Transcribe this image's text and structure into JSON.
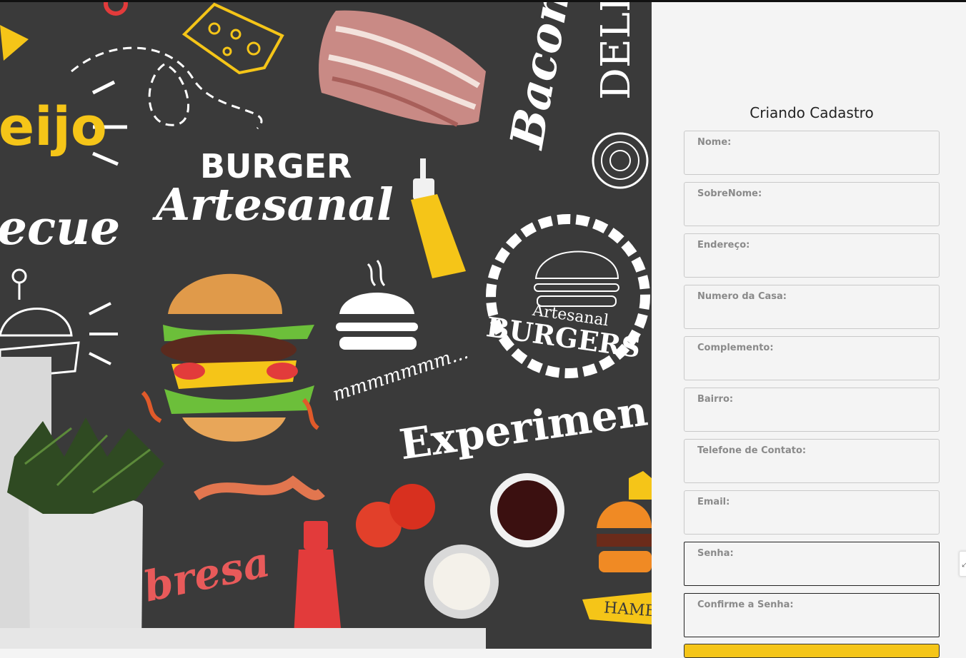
{
  "hero": {
    "texts": {
      "queijo": "eijo",
      "barbecue": "ecue",
      "burger_title": "BURGER",
      "artesanal": "Artesanal",
      "bacon": "Bacon",
      "delicious": "DELIC",
      "badge_artesanal": "Artesanal",
      "badge_burgers": "BURGERS",
      "mmm": "mmmmmmm...",
      "experimente": "Experimen",
      "calabresa": "bresa",
      "hamburger": "HAMB"
    },
    "colors": {
      "board": "#3a3a3a",
      "yellow": "#f5c518",
      "red": "#e23b3b"
    }
  },
  "form": {
    "title": "Criando Cadastro",
    "fields": [
      {
        "label": "Nome:",
        "value": ""
      },
      {
        "label": "SobreNome:",
        "value": ""
      },
      {
        "label": "Endereço:",
        "value": ""
      },
      {
        "label": "Numero da Casa:",
        "value": ""
      },
      {
        "label": "Complemento:",
        "value": ""
      },
      {
        "label": "Bairro:",
        "value": ""
      },
      {
        "label": "Telefone de Contato:",
        "value": ""
      },
      {
        "label": "Email:",
        "value": ""
      },
      {
        "label": "Senha:",
        "value": ""
      },
      {
        "label": "Confirme a Senha:",
        "value": ""
      }
    ],
    "submit_color": "#f5c518"
  },
  "side_tab": {
    "glyph": "⤢"
  }
}
